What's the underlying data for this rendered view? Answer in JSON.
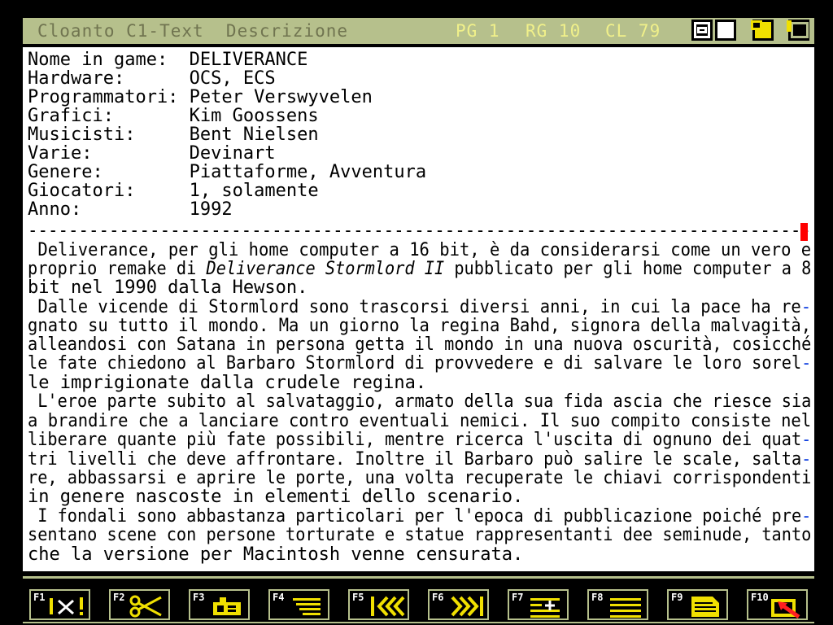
{
  "titlebar": {
    "app_title": "Cloanto C1-Text  Descrizione",
    "page": "PG 1",
    "row": "RG 10",
    "column": "CL 79"
  },
  "document": {
    "header_lines": [
      "Nome in game:  DELIVERANCE",
      "Hardware:      OCS, ECS",
      "Programmatori: Peter Verswyvelen",
      "Grafici:       Kim Goossens",
      "Musicisti:     Bent Nielsen",
      "Varie:         Devinart",
      "Genere:        Piattaforme, Avventura",
      "Giocatori:     1, solamente",
      "Anno:          1992"
    ],
    "separator": "-----------------------------------------------------------------------------",
    "body_lines": [
      " Deliverance, per gli home computer a 16 bit, è da considerarsi come un vero e",
      "proprio remake di ",
      "Deliverance Stormlord II",
      " pubblicato per gli home computer a 8",
      "bit nel 1990 dalla Hewson.",
      " Dalle vicende di Stormlord sono trascorsi diversi anni, in cui la pace ha re",
      "gnato su tutto il mondo. Ma un giorno la regina Bahd, signora della malvagità,",
      "alleandosi con Satana in persona getta il mondo in una nuova oscurità, cosicché",
      "le fate chiedono al Barbaro Stormlord di provvedere e di salvare le loro sorel",
      "le imprigionate dalla crudele regina.",
      " L'eroe parte subito al salvataggio, armato della sua fida ascia che riesce sia",
      "a brandire che a lanciare contro eventuali nemici. Il suo compito consiste nel",
      "liberare quante più fate possibili, mentre ricerca l'uscita di ognuno dei quat",
      "tri livelli che deve affrontare. Inoltre il Barbaro può salire le scale, salta",
      "re, abbassarsi e aprire le porte, una volta recuperate le chiavi corrispondenti",
      "in genere nascoste in elementi dello scenario.",
      " I fondali sono abbastanza particolari per l'epoca di pubblicazione poiché pre",
      "sentano scene con persone torturate e statue rappresentanti dee seminude, tanto",
      "che la versione per Macintosh venne censurata."
    ],
    "soft_hyphen": "-"
  },
  "fkeys": [
    {
      "label": "F1",
      "icon": "help-icon"
    },
    {
      "label": "F2",
      "icon": "scissors-icon"
    },
    {
      "label": "F3",
      "icon": "paste-icon"
    },
    {
      "label": "F4",
      "icon": "format-icon"
    },
    {
      "label": "F5",
      "icon": "rewind-icon"
    },
    {
      "label": "F6",
      "icon": "fast-forward-icon"
    },
    {
      "label": "F7",
      "icon": "insert-icon"
    },
    {
      "label": "F8",
      "icon": "justify-icon"
    },
    {
      "label": "F9",
      "icon": "document-icon"
    },
    {
      "label": "F10",
      "icon": "exit-icon"
    }
  ],
  "colors": {
    "titlebar_bg": "#b6c08c",
    "status_text": "#f0f08a",
    "cursor": "#ff0000",
    "hyphen": "#1040e0",
    "icon_yellow": "#f0e000"
  }
}
